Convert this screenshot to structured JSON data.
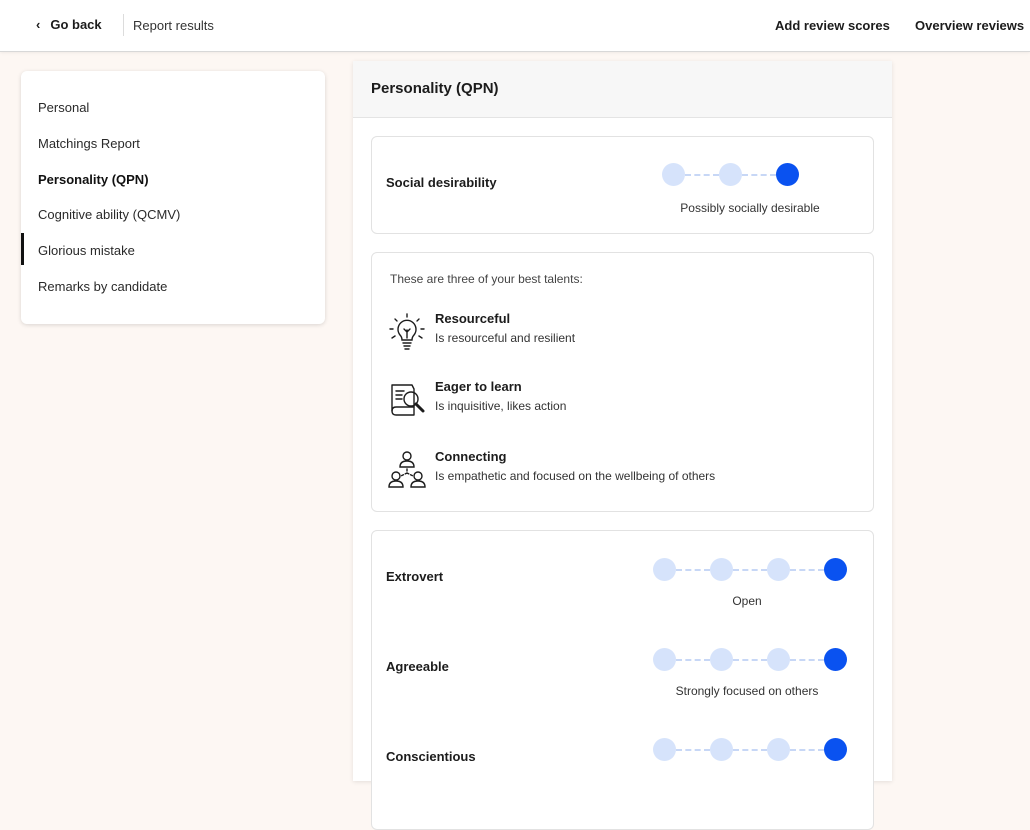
{
  "header": {
    "back_chevron": "‹",
    "back_label": "Go back",
    "breadcrumb": "Report results",
    "links": [
      "Add review scores",
      "Overview reviews"
    ]
  },
  "sidebar": {
    "items": [
      {
        "label": "Personal",
        "active": false
      },
      {
        "label": "Matchings Report",
        "active": false
      },
      {
        "label": "Personality (QPN)",
        "active": true
      },
      {
        "label": "Cognitive ability (QCMV)",
        "active": false
      },
      {
        "label": "Glorious mistake",
        "active": false
      },
      {
        "label": "Remarks by candidate",
        "active": false
      }
    ]
  },
  "main": {
    "title": "Personality (QPN)",
    "social": {
      "label": "Social desirability",
      "scale_steps": 3,
      "selected_step": 3,
      "result": "Possibly socially desirable"
    },
    "talents": {
      "intro": "These are three of your best talents:",
      "items": [
        {
          "icon": "lightbulb-icon",
          "name": "Resourceful",
          "desc": "Is resourceful and resilient"
        },
        {
          "icon": "book-magnifier-icon",
          "name": "Eager to learn",
          "desc": "Is inquisitive, likes action"
        },
        {
          "icon": "people-network-icon",
          "name": "Connecting",
          "desc": "Is empathetic and focused on the wellbeing of others"
        }
      ]
    },
    "traits": [
      {
        "label": "Extrovert",
        "scale_steps": 4,
        "selected_step": 4,
        "result": "Open"
      },
      {
        "label": "Agreeable",
        "scale_steps": 4,
        "selected_step": 4,
        "result": "Strongly focused on others"
      },
      {
        "label": "Conscientious",
        "scale_steps": 4,
        "selected_step": 4,
        "result": ""
      }
    ]
  },
  "colors": {
    "accent": "#0a52f0",
    "dot_inactive": "#d6e3fb",
    "page_bg": "#fdf7f3"
  }
}
